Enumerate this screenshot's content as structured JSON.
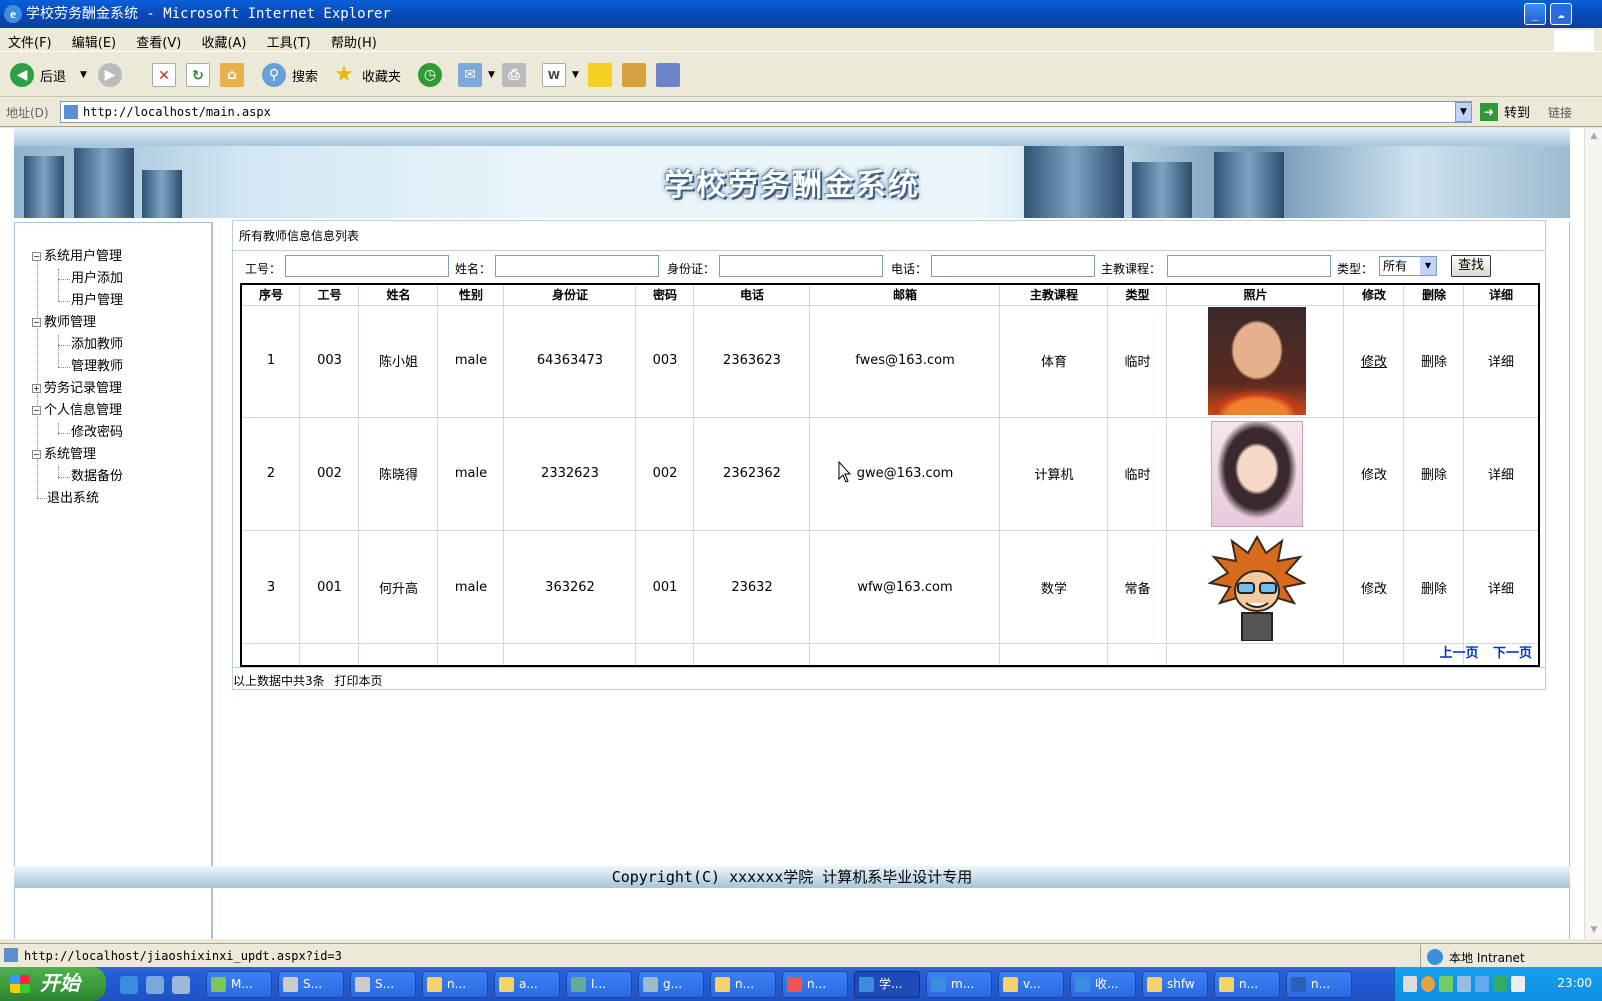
{
  "window": {
    "title": "学校劳务酬金系统 - Microsoft Internet Explorer"
  },
  "menu": [
    "文件(F)",
    "编辑(E)",
    "查看(V)",
    "收藏(A)",
    "工具(T)",
    "帮助(H)"
  ],
  "toolbar": {
    "back": "后退",
    "search": "搜索",
    "favorites": "收藏夹"
  },
  "address": {
    "label": "地址(D)",
    "url": "http://localhost/main.aspx",
    "go": "转到",
    "links": "链接"
  },
  "banner": {
    "title": "学校劳务酬金系统"
  },
  "sidebar": {
    "items": [
      {
        "label": "系统用户管理"
      },
      {
        "label": "用户添加"
      },
      {
        "label": "用户管理"
      },
      {
        "label": "教师管理"
      },
      {
        "label": "添加教师"
      },
      {
        "label": "管理教师"
      },
      {
        "label": "劳务记录管理"
      },
      {
        "label": "个人信息管理"
      },
      {
        "label": "修改密码"
      },
      {
        "label": "系统管理"
      },
      {
        "label": "数据备份"
      },
      {
        "label": "退出系统"
      }
    ]
  },
  "panel": {
    "title": "所有教师信息信息列表"
  },
  "search": {
    "labels": [
      "工号：",
      "姓名：",
      "身份证：",
      "电话：",
      "主教课程：",
      "类型："
    ],
    "type_value": "所有",
    "button": "查找"
  },
  "table": {
    "headers": [
      "序号",
      "工号",
      "姓名",
      "性别",
      "身份证",
      "密码",
      "电话",
      "邮箱",
      "主教课程",
      "类型",
      "照片",
      "修改",
      "删除",
      "详细"
    ],
    "rows": [
      {
        "no": "1",
        "id": "003",
        "name": "陈小姐",
        "sex": "male",
        "idcard": "64363473",
        "pwd": "003",
        "phone": "2363623",
        "email": "fwes@163.com",
        "course": "体育",
        "type": "临时",
        "edit": "修改",
        "del": "删除",
        "detail": "详细"
      },
      {
        "no": "2",
        "id": "002",
        "name": "陈晓得",
        "sex": "male",
        "idcard": "2332623",
        "pwd": "002",
        "phone": "2362362",
        "email": "gwe@163.com",
        "course": "计算机",
        "type": "临时",
        "edit": "修改",
        "del": "删除",
        "detail": "详细"
      },
      {
        "no": "3",
        "id": "001",
        "name": "何升高",
        "sex": "male",
        "idcard": "363262",
        "pwd": "001",
        "phone": "23632",
        "email": "wfw@163.com",
        "course": "数学",
        "type": "常备",
        "edit": "修改",
        "del": "删除",
        "detail": "详细"
      }
    ],
    "prev": "上一页",
    "next": "下一页",
    "summary": "以上数据中共3条",
    "print": "打印本页"
  },
  "footer": {
    "copyright": "Copyright(C) xxxxxx学院 计算机系毕业设计专用"
  },
  "status": {
    "url": "http://localhost/jiaoshixinxi_updt.aspx?id=3",
    "zone": "本地 Intranet"
  },
  "taskbar": {
    "start": "开始",
    "tasks": [
      "M...",
      "S...",
      "S...",
      "n...",
      "a...",
      "I...",
      "g...",
      "n...",
      "n...",
      "学...",
      "m...",
      "v...",
      "收...",
      "shfw",
      "n...",
      "n..."
    ],
    "clock": "23:00"
  },
  "colors": {
    "titlebar": "#0747b3",
    "link_blue": "#0033cc",
    "taskbar": "#245edc",
    "start_green": "#3a9a3a"
  }
}
